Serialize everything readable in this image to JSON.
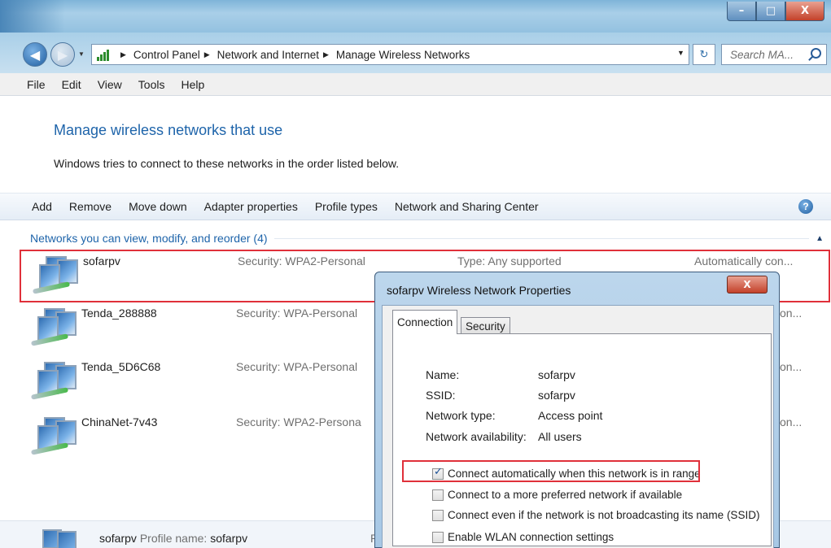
{
  "window": {
    "buttons": {
      "minimize": "–",
      "maximize": "□",
      "close": "X"
    }
  },
  "addressbar": {
    "crumbs": [
      "Control Panel",
      "Network and Internet",
      "Manage Wireless Networks"
    ],
    "search_placeholder": "Search MA..."
  },
  "menu": [
    "File",
    "Edit",
    "View",
    "Tools",
    "Help"
  ],
  "main": {
    "heading": "Manage wireless networks that use",
    "subtext": "Windows tries to connect to these networks in the order listed below."
  },
  "toolbar": {
    "items": [
      "Add",
      "Remove",
      "Move down",
      "Adapter properties",
      "Profile types",
      "Network and Sharing Center"
    ],
    "help": "?"
  },
  "group": {
    "header": "Networks you can view, modify, and reorder (4)"
  },
  "networks": [
    {
      "name": "sofarpv",
      "security": "Security: WPA2-Personal",
      "type": "Type: Any supported",
      "auto": "Automatically con..."
    },
    {
      "name": "Tenda_288888",
      "security": "Security: WPA-Personal",
      "trail": "on..."
    },
    {
      "name": "Tenda_5D6C68",
      "security": "Security: WPA-Personal",
      "trail": "on..."
    },
    {
      "name": "ChinaNet-7v43",
      "security": "Security: WPA2-Persona",
      "trail": "on..."
    }
  ],
  "footer": {
    "name": "sofarpv",
    "label": "Profile name:",
    "value": "sofarpv",
    "trail": "R"
  },
  "dialog": {
    "title": "sofarpv Wireless Network Properties",
    "close": "X",
    "tabs": [
      "Connection",
      "Security"
    ],
    "fields": [
      {
        "label": "Name:",
        "value": "sofarpv"
      },
      {
        "label": "SSID:",
        "value": "sofarpv"
      },
      {
        "label": "Network type:",
        "value": "Access point"
      },
      {
        "label": "Network availability:",
        "value": "All users"
      }
    ],
    "checkboxes": [
      {
        "label": "Connect automatically when this network is in range",
        "checked": true
      },
      {
        "label": "Connect to a more preferred network if available",
        "checked": false
      },
      {
        "label": "Connect even if the network is not broadcasting its name (SSID)",
        "checked": false
      },
      {
        "label": "Enable WLAN connection settings",
        "checked": false
      }
    ]
  },
  "colors": {
    "accent": "#1e64aa",
    "highlight": "#e0303a"
  }
}
